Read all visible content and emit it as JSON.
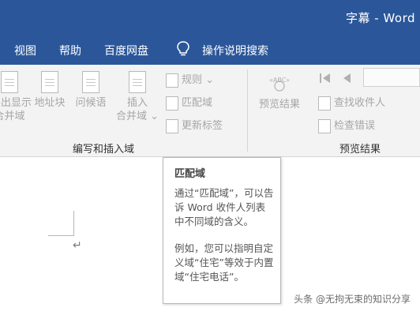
{
  "window": {
    "title": "字幕  -  Word"
  },
  "menu": {
    "items": [
      "视图",
      "帮助",
      "百度网盘"
    ],
    "tell_me": {
      "icon": "lightbulb-icon",
      "label": "操作说明搜索"
    }
  },
  "ribbon": {
    "write_insert_group": {
      "label": "编写和插入域",
      "buttons": [
        {
          "icon": "document-icon",
          "line1": "突出显示",
          "line2": "合并域"
        },
        {
          "icon": "document-icon",
          "line1": "地址块",
          "line2": ""
        },
        {
          "icon": "document-icon",
          "line1": "问候语",
          "line2": ""
        },
        {
          "icon": "document-table-icon",
          "line1": "插入",
          "line2": "合并域"
        }
      ],
      "small_buttons": [
        {
          "icon": "rules-icon",
          "label": "规则"
        },
        {
          "icon": "match-fields-icon",
          "label": "匹配域"
        },
        {
          "icon": "update-labels-icon",
          "label": "更新标签"
        }
      ]
    },
    "preview_group": {
      "label": "预览结果",
      "big_button": {
        "icon": "abc-preview-icon",
        "label": "预览结果"
      },
      "small_buttons": [
        {
          "icon": "find-recipient-icon",
          "label": "查找收件人"
        },
        {
          "icon": "check-errors-icon",
          "label": "检查错误"
        }
      ]
    },
    "colors": {
      "titlebar": "#2b579a",
      "ribbon_bg": "#f3f3f3",
      "disabled_text": "#a6a6a6"
    }
  },
  "document": {
    "paragraph_mark": "↵"
  },
  "tooltip": {
    "title": "匹配域",
    "paragraph1": "通过“匹配域”，可以告诉 Word 收件人列表中不同域的含义。",
    "paragraph2": "例如，您可以指明自定义域“住宅”等效于内置域“住宅电话”。"
  },
  "watermark": "头条 @无拘无束的知识分享"
}
